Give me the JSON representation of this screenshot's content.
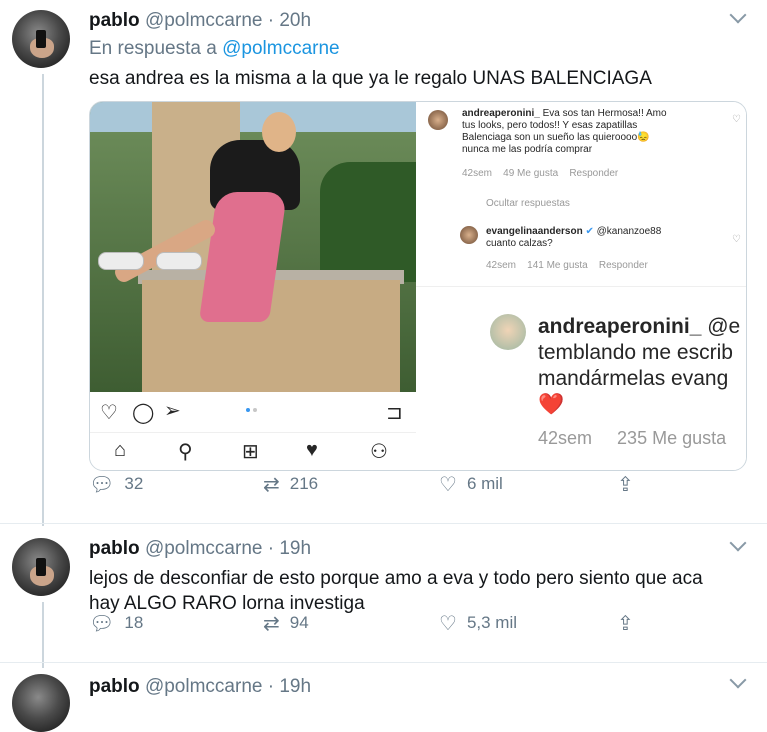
{
  "tweet1": {
    "name": "pablo",
    "handle": "@polmccarne",
    "time": "· 20h",
    "reply_prefix": "En respuesta a",
    "reply_handle": "@polmccarne",
    "text": "esa andrea es la misma a la que ya le regalo UNAS BALENCIAGA",
    "replies": "32",
    "retweets": "216",
    "likes": "6 mil"
  },
  "embed": {
    "comment1": {
      "user": "andreaperonini_",
      "text_line1": " Eva sos tan Hermosa!! Amo",
      "text_line2": "tus looks, pero todos!! Y esas zapatillas",
      "text_line3": "Balenciaga son un sueño las quieroooo😓",
      "text_line4": "nunca me las podría comprar",
      "age": "42sem",
      "likes": "49 Me gusta",
      "reply": "Responder"
    },
    "hide_replies": "Ocultar respuestas",
    "comment2": {
      "user": "evangelinaanderson",
      "mention": " @kananzoe88",
      "text": "cuanto calzas?",
      "age": "42sem",
      "likes": "141 Me gusta",
      "reply": "Responder"
    },
    "comment3": {
      "user": "andreaperonini_",
      "mention": " @e",
      "line2": "temblando me escrib",
      "line3": "mandármelas evang",
      "emoji": "❤️",
      "age": "42sem",
      "likes": "235 Me gusta"
    }
  },
  "tweet2": {
    "name": "pablo",
    "handle": "@polmccarne",
    "time": "· 19h",
    "text_line1": "lejos de desconfiar de esto porque amo a eva y todo pero siento que aca",
    "text_line2": "hay ALGO RARO lorna investiga",
    "replies": "18",
    "retweets": "94",
    "likes": "5,3 mil"
  },
  "tweet3": {
    "name": "pablo",
    "handle": "@polmccarne",
    "time": "· 19h"
  }
}
